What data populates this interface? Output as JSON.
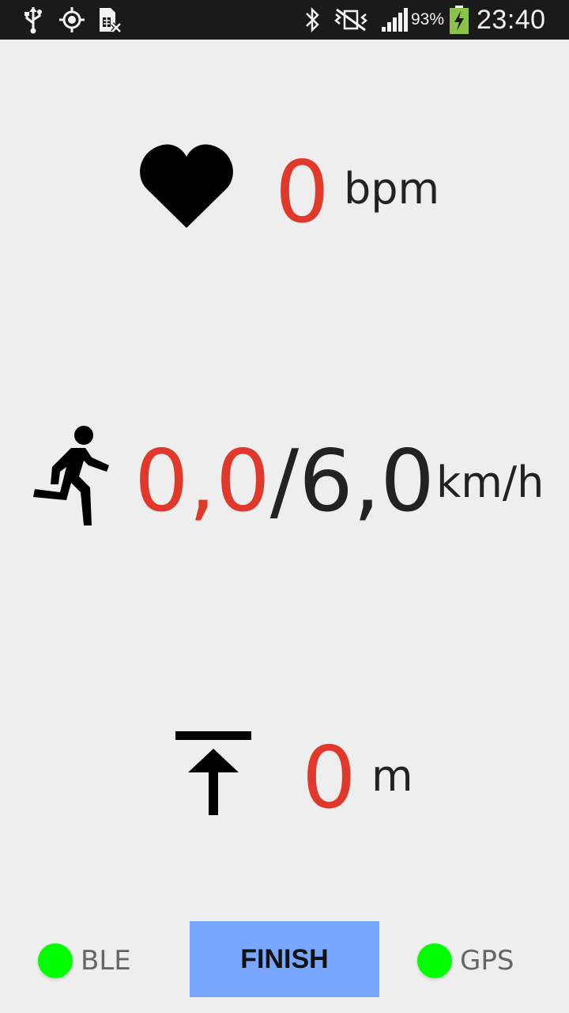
{
  "status_bar": {
    "icons": [
      "usb-icon",
      "gps-icon",
      "no-sim-icon",
      "bluetooth-icon",
      "vibrate-icon",
      "signal-icon",
      "battery-charging-icon"
    ],
    "battery_percent": "93%",
    "time": "23:40"
  },
  "heart_rate": {
    "icon": "heart-icon",
    "value": "0",
    "unit": "bpm"
  },
  "speed": {
    "icon": "running-person-icon",
    "current": "0,0",
    "separator": "/",
    "target": "6,0",
    "unit": "km/h"
  },
  "elevation": {
    "icon": "elevation-icon",
    "value": "0",
    "unit": "m"
  },
  "footer": {
    "ble_label": "BLE",
    "finish_label": "FINISH",
    "gps_label": "GPS"
  },
  "colors": {
    "value_red": "#e0392b",
    "indicator_green": "#00ff00",
    "finish_blue": "#77a7ff",
    "background": "#eeeeee"
  }
}
